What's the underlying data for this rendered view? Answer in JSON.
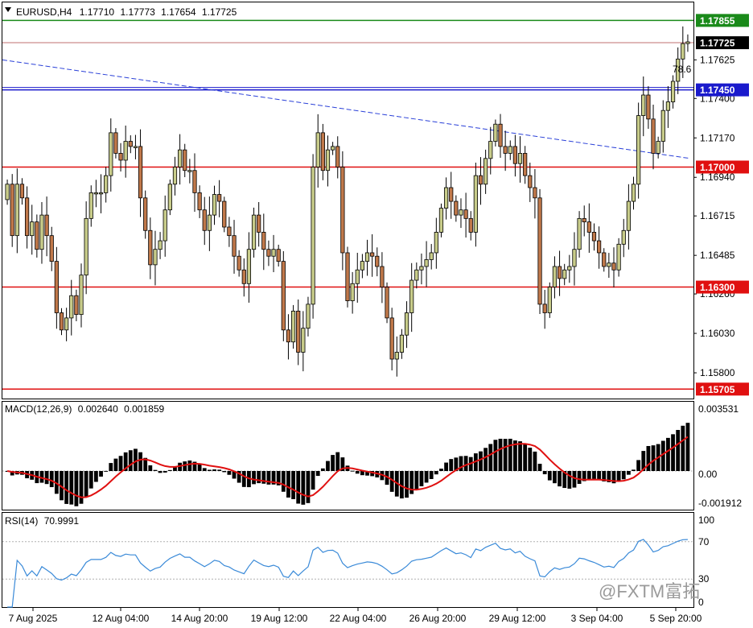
{
  "header": {
    "symbol": "EURUSD,H4",
    "open": "1.17710",
    "high": "1.17773",
    "low": "1.17654",
    "close": "1.17725"
  },
  "watermark": "@FXTM富拓",
  "colors": {
    "bull_body": "#c8cc8a",
    "bear_body": "#c0784a",
    "wick": "#000000",
    "support_resistance": "#e01010",
    "blue_level": "#1a1acc",
    "green_level": "#1a8a1a",
    "trendline": "#2a40d8",
    "macd_hist": "#000000",
    "macd_signal": "#e01010",
    "rsi_line": "#3a8ad8",
    "badge_red": "#e01010",
    "badge_blue": "#1a1acc",
    "badge_green": "#1a8a1a",
    "badge_black": "#000000"
  },
  "chart_data": [
    {
      "type": "candlestick",
      "price_axis_ticks": [
        "1.17625",
        "1.17400",
        "1.17170",
        "1.16940",
        "1.16715",
        "1.16485",
        "1.16260",
        "1.16030",
        "1.15800"
      ],
      "ylim": [
        1.1565,
        1.1796
      ],
      "levels": [
        {
          "price": 1.17855,
          "label": "1.17855",
          "color": "green"
        },
        {
          "price": 1.17725,
          "label": "1.17725",
          "color": "black"
        },
        {
          "price": 1.1745,
          "label": "1.17450",
          "color": "blue"
        },
        {
          "price": 1.17,
          "label": "1.17000",
          "color": "red"
        },
        {
          "price": 1.163,
          "label": "1.16300",
          "color": "red"
        },
        {
          "price": 1.15705,
          "label": "1.15705",
          "color": "red"
        }
      ],
      "fib_label": "78.6",
      "trendline": {
        "start": 1.17625,
        "end": 1.1705
      },
      "x_labels": [
        "7 Aug 2025",
        "12 Aug 04:00",
        "14 Aug 20:00",
        "19 Aug 12:00",
        "22 Aug 04:00",
        "26 Aug 20:00",
        "29 Aug 12:00",
        "3 Sep 04:00",
        "5 Sep 20:00"
      ],
      "closes": [
        1.169,
        1.166,
        1.169,
        1.1682,
        1.166,
        1.1668,
        1.1652,
        1.1672,
        1.166,
        1.1645,
        1.1615,
        1.1605,
        1.1612,
        1.1625,
        1.1614,
        1.1637,
        1.167,
        1.1685,
        1.1685,
        1.1685,
        1.1695,
        1.172,
        1.1708,
        1.1704,
        1.1715,
        1.1712,
        1.1712,
        1.1682,
        1.1663,
        1.1643,
        1.1652,
        1.1657,
        1.1675,
        1.169,
        1.17,
        1.171,
        1.1698,
        1.1698,
        1.1685,
        1.1675,
        1.1663,
        1.1672,
        1.1684,
        1.168,
        1.1665,
        1.166,
        1.1648,
        1.164,
        1.1632,
        1.1652,
        1.1672,
        1.1662,
        1.1652,
        1.1648,
        1.1652,
        1.1645,
        1.1605,
        1.1598,
        1.1616,
        1.1592,
        1.1606,
        1.162,
        1.17,
        1.172,
        1.1698,
        1.171,
        1.1712,
        1.17,
        1.165,
        1.1622,
        1.1632,
        1.164,
        1.1645,
        1.165,
        1.1648,
        1.1642,
        1.163,
        1.1612,
        1.1588,
        1.1592,
        1.1602,
        1.1615,
        1.1634,
        1.164,
        1.1642,
        1.1646,
        1.165,
        1.1662,
        1.1676,
        1.1688,
        1.168,
        1.1672,
        1.1675,
        1.167,
        1.1662,
        1.1695,
        1.169,
        1.1705,
        1.1715,
        1.1725,
        1.1712,
        1.1708,
        1.1712,
        1.1702,
        1.1708,
        1.1695,
        1.1688,
        1.1682,
        1.162,
        1.1615,
        1.163,
        1.1642,
        1.1635,
        1.164,
        1.1642,
        1.1652,
        1.167,
        1.1668,
        1.1662,
        1.1657,
        1.165,
        1.1642,
        1.1644,
        1.164,
        1.1655,
        1.1663,
        1.168,
        1.169,
        1.173,
        1.1742,
        1.1728,
        1.1708,
        1.1715,
        1.1733,
        1.1738,
        1.175,
        1.1763,
        1.1772,
        1.1773
      ],
      "macd": {
        "label": "MACD(12,26,9)",
        "value1": "0.002640",
        "value2": "0.001859",
        "ticks": [
          "0.003531",
          "0.00",
          "-0.001912"
        ]
      },
      "rsi": {
        "label": "RSI(14)",
        "value": "70.9991",
        "ticks": [
          "100",
          "70",
          "30",
          "0"
        ]
      }
    }
  ]
}
